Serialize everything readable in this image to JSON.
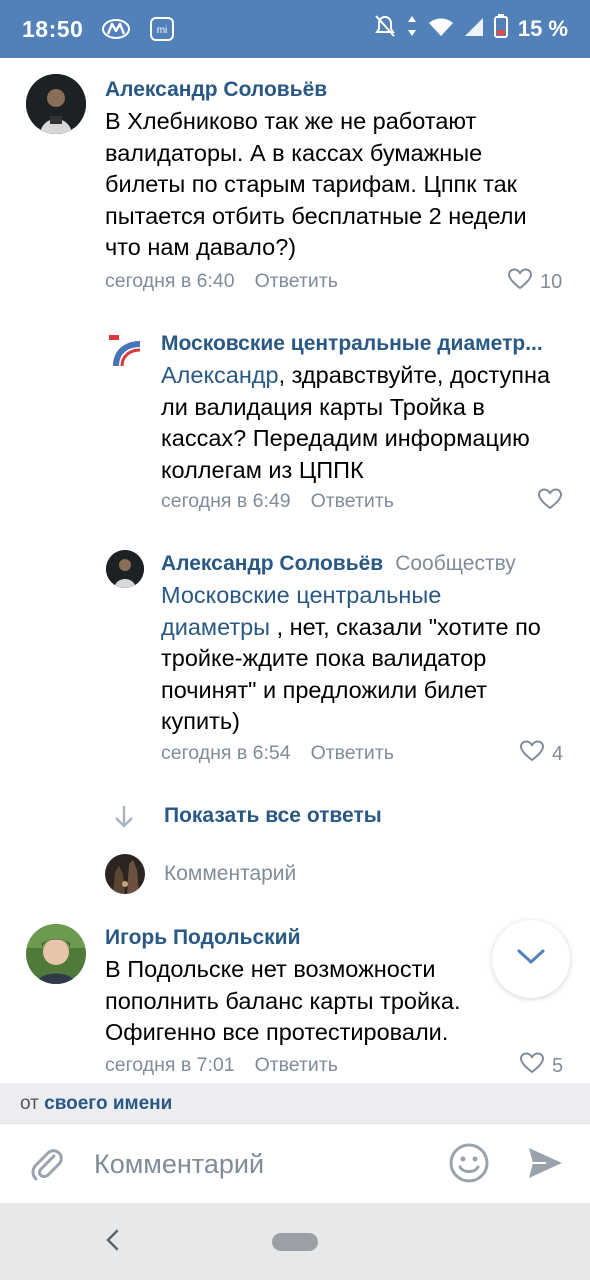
{
  "status_bar": {
    "time": "18:50",
    "battery": "15 %",
    "bg_color": "#5181b8",
    "icons": [
      "metro-icon",
      "mi-icon",
      "mute-icon",
      "data-arrows-icon",
      "wifi-icon",
      "signal-icon",
      "battery-low-icon"
    ]
  },
  "comments": [
    {
      "author": "Александр Соловьёв",
      "text": "В Хлебниково так же не работают валидаторы. А в кассах бумажные билеты по старым тарифам. Цппк так пытается отбить бесплатные 2 недели что нам давало?)",
      "time": "сегодня в 6:40",
      "reply_label": "Ответить",
      "likes": "10"
    },
    {
      "author": "Московские центральные диаметр...",
      "mention": "Александр",
      "text": ", здравствуйте, доступна ли валидация карты Тройка в кассах? Передадим информацию коллегам из ЦППК",
      "time": "сегодня в 6:49",
      "reply_label": "Ответить",
      "likes": ""
    },
    {
      "author": "Александр Соловьёв",
      "author_extra": "Сообществу",
      "mention": "Московские центральные диаметры",
      "text": " , нет, сказали \"хотите по тройке-ждите пока валидатор починят\" и предложили билет купить)",
      "time": "сегодня в 6:54",
      "reply_label": "Ответить",
      "likes": "4"
    },
    {
      "author": "Игорь Подольский",
      "text": "В Подольске нет возможности пополнить баланс карты тройка. Офигенно все протестировали.",
      "time": "сегодня в 7:01",
      "reply_label": "Ответить",
      "likes": "5"
    }
  ],
  "show_all_replies": "Показать все ответы",
  "reply_field_placeholder": "Комментарий",
  "post_as": {
    "prefix": "от",
    "link": "своего имени"
  },
  "composer": {
    "placeholder": "Комментарий"
  },
  "colors": {
    "link": "#2a5885",
    "secondary": "#818c99",
    "accent": "#5181b8"
  }
}
